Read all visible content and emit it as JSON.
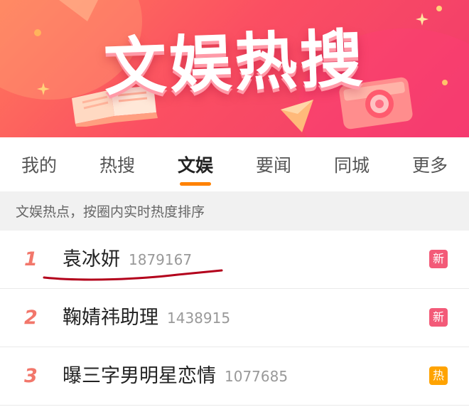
{
  "banner": {
    "title": "文娱热搜"
  },
  "tabs": [
    {
      "label": "我的"
    },
    {
      "label": "热搜"
    },
    {
      "label": "文娱"
    },
    {
      "label": "要闻"
    },
    {
      "label": "同城"
    },
    {
      "label": "更多"
    }
  ],
  "active_tab": "文娱",
  "section_header": "文娱热点，按圈内实时热度排序",
  "items": [
    {
      "rank": "1",
      "title": "袁冰妍",
      "count": "1879167",
      "badge": "新",
      "badge_type": "new"
    },
    {
      "rank": "2",
      "title": "鞠婧祎助理",
      "count": "1438915",
      "badge": "新",
      "badge_type": "new"
    },
    {
      "rank": "3",
      "title": "曝三字男明星恋情",
      "count": "1077685",
      "badge": "热",
      "badge_type": "hot"
    }
  ],
  "colors": {
    "accent": "#ff8200",
    "rank": "#f2776b",
    "badge_new": "#f35a78",
    "badge_hot": "#ffa300",
    "pen_mark": "#b3001b"
  }
}
